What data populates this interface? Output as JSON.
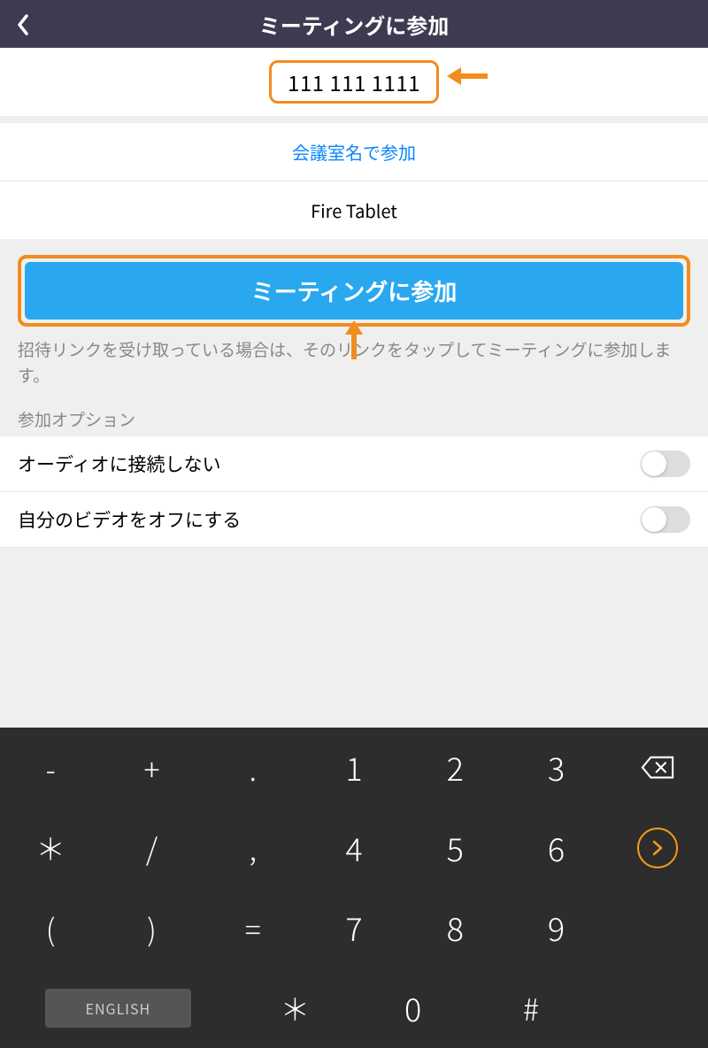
{
  "header": {
    "title": "ミーティングに参加"
  },
  "meeting_id_input": "111 111 1111",
  "join_by_name_link": "会議室名で参加",
  "device_name": "Fire Tablet",
  "join_button": "ミーティングに参加",
  "help_text": "招待リンクを受け取っている場合は、そのリンクをタップしてミーティングに参加します。",
  "options_label": "参加オプション",
  "options": {
    "no_audio": "オーディオに接続しない",
    "video_off": "自分のビデオをオフにする"
  },
  "keyboard": {
    "rows": [
      [
        "-",
        "+",
        ".",
        "1",
        "2",
        "3"
      ],
      [
        "＊",
        "/",
        ",",
        "4",
        "5",
        "6"
      ],
      [
        "(",
        ")",
        "=",
        "7",
        "8",
        "9"
      ],
      [
        "＊",
        "0",
        "#"
      ]
    ],
    "language": "ENGLISH"
  }
}
